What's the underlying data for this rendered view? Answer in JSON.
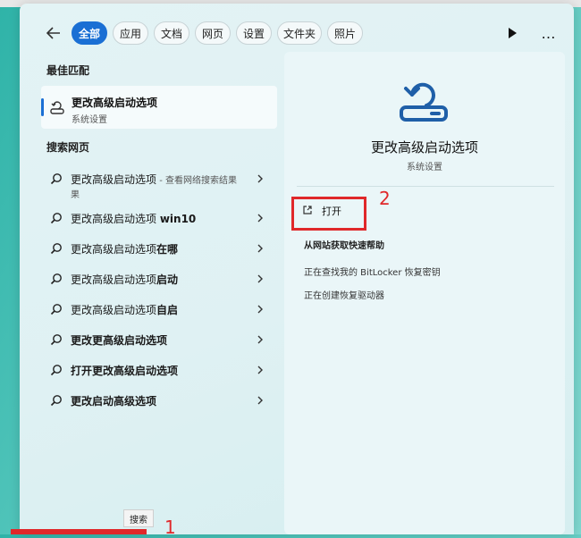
{
  "filters": {
    "items": [
      "全部",
      "应用",
      "文档",
      "网页",
      "设置",
      "文件夹",
      "照片"
    ],
    "active_index": 0,
    "more": "…"
  },
  "sections": {
    "best_match": "最佳匹配",
    "search_web": "搜索网页"
  },
  "best_match": {
    "title": "更改高级启动选项",
    "subtitle": "系统设置"
  },
  "web_results": [
    {
      "main": "更改高级启动选项",
      "hint": " - 查看网络搜索结果",
      "line2": "果"
    },
    {
      "main": "更改高级启动选项 ",
      "bold": "win10"
    },
    {
      "main": "更改高级启动选项",
      "bold": "在哪"
    },
    {
      "main": "更改高级启动选项",
      "bold": "启动"
    },
    {
      "main": "更改高级启动选项",
      "bold": "自启"
    },
    {
      "main": "",
      "bold": "更改更高级启动选项"
    },
    {
      "main": "",
      "bold": "打开更改高级启动选项"
    },
    {
      "main": "",
      "bold": "更改启动高级选项"
    }
  ],
  "detail": {
    "title": "更改高级启动选项",
    "subtitle": "系统设置",
    "open_label": "打开",
    "help_title": "从网站获取快速帮助",
    "links": [
      "正在查找我的 BitLocker 恢复密钥",
      "正在创建恢复驱动器"
    ]
  },
  "annotations": {
    "step1": "1",
    "step2": "2",
    "annotation_color": "#e0282a"
  },
  "taskbar": {
    "search_tooltip": "搜索"
  },
  "colors": {
    "accent": "#1a6fd4"
  }
}
